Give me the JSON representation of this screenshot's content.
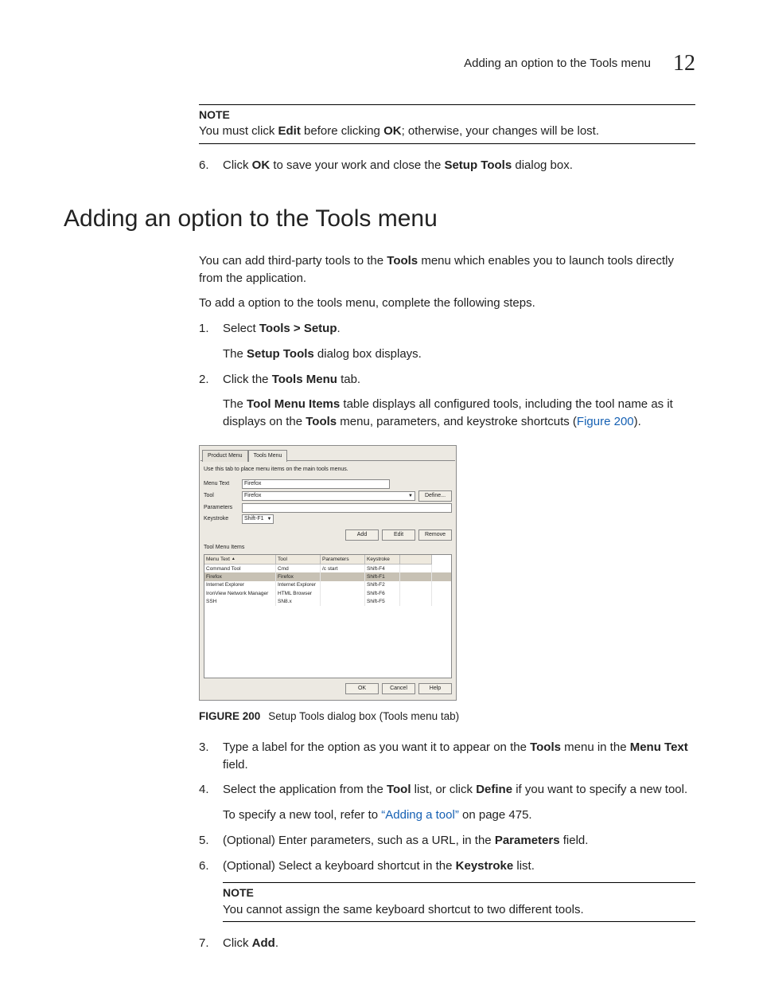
{
  "header": {
    "title": "Adding an option to the Tools menu",
    "chapter": "12"
  },
  "intro_note": {
    "label": "NOTE",
    "text_pre": "You must click ",
    "edit": "Edit",
    "text_mid": " before clicking ",
    "ok": "OK",
    "text_post": "; otherwise, your changes will be lost."
  },
  "step_prev6": {
    "num": "6.",
    "pre": "Click ",
    "ok": "OK",
    "mid": " to save your work and close the ",
    "st": "Setup Tools",
    "post": " dialog box."
  },
  "section_heading": "Adding an option to the Tools menu",
  "p1": {
    "pre": "You can add third-party tools to the ",
    "tools": "Tools",
    "post": " menu which enables you to launch tools directly from the application."
  },
  "p2": "To add a option to the tools menu, complete the following steps.",
  "s1": {
    "num": "1.",
    "pre": "Select ",
    "path": "Tools > Setup",
    "dot": ".",
    "sub_pre": "The ",
    "st": "Setup Tools",
    "sub_post": " dialog box displays."
  },
  "s2": {
    "num": "2.",
    "pre": "Click the ",
    "tab": "Tools Menu",
    "post": " tab.",
    "sub_pre": "The ",
    "tmi": "Tool Menu Items",
    "sub_mid": " table displays all configured tools, including the tool name as it displays on the ",
    "tools": "Tools",
    "sub_mid2": " menu, parameters, and keystroke shortcuts (",
    "figref": "Figure 200",
    "sub_post": ")."
  },
  "dialog": {
    "tabs": {
      "product": "Product Menu",
      "tools": "Tools Menu"
    },
    "desc": "Use this tab to place menu items on the main tools menus.",
    "labels": {
      "menu_text": "Menu Text",
      "tool": "Tool",
      "parameters": "Parameters",
      "keystroke": "Keystroke"
    },
    "values": {
      "menu_text": "Firefox",
      "tool": "Firefox",
      "parameters": "",
      "keystroke": "Shift-F1"
    },
    "buttons": {
      "define": "Define...",
      "add": "Add",
      "edit": "Edit",
      "remove": "Remove",
      "ok": "OK",
      "cancel": "Cancel",
      "help": "Help"
    },
    "table": {
      "title": "Tool Menu Items",
      "headers": {
        "menu_text": "Menu Text",
        "tool": "Tool",
        "parameters": "Parameters",
        "keystroke": "Keystroke"
      },
      "rows": [
        {
          "menu_text": "Command Tool",
          "tool": "Cmd",
          "parameters": "/c start",
          "keystroke": "Shift-F4"
        },
        {
          "menu_text": "Firefox",
          "tool": "Firefox",
          "parameters": "",
          "keystroke": "Shift-F1"
        },
        {
          "menu_text": "Internet Explorer",
          "tool": "Internet Explorer",
          "parameters": "",
          "keystroke": "Shift-F2"
        },
        {
          "menu_text": "IronView Network Manager",
          "tool": "HTML Browser",
          "parameters": "",
          "keystroke": "Shift-F6"
        },
        {
          "menu_text": "SSH",
          "tool": "SN8.x",
          "parameters": "",
          "keystroke": "Shift-F5"
        }
      ],
      "selected_index": 1
    }
  },
  "figcap": {
    "num": "FIGURE 200",
    "text": "Setup Tools dialog box (Tools menu tab)"
  },
  "s3": {
    "num": "3.",
    "pre": "Type a label for the option as you want it to appear on the ",
    "tools": "Tools",
    "mid": " menu in the ",
    "mt": "Menu Text",
    "post": " field."
  },
  "s4": {
    "num": "4.",
    "pre": "Select the application from the ",
    "tool": "Tool",
    "mid": " list, or click ",
    "define": "Define",
    "post": " if you want to specify a new tool.",
    "sub_pre": "To specify a new tool, refer to ",
    "link": "“Adding a tool”",
    "sub_post": " on page 475."
  },
  "s5": {
    "num": "5.",
    "pre": "(Optional) Enter parameters, such as a URL, in the ",
    "params": "Parameters",
    "post": " field."
  },
  "s6": {
    "num": "6.",
    "pre": "(Optional) Select a keyboard shortcut in the ",
    "ks": "Keystroke",
    "post": " list."
  },
  "note2": {
    "label": "NOTE",
    "text": "You cannot assign the same keyboard shortcut to two different tools."
  },
  "s7": {
    "num": "7.",
    "pre": "Click ",
    "add": "Add",
    "post": "."
  }
}
